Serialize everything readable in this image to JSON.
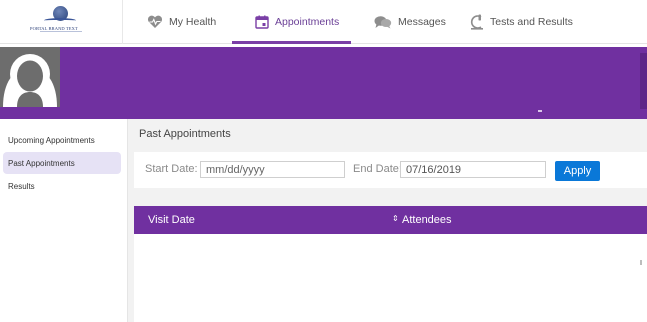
{
  "nav": {
    "logo_text": "PORTAL BRAND TEXT",
    "tabs": [
      {
        "label": "My Health",
        "icon": "heart-pulse-icon"
      },
      {
        "label": "Appointments",
        "icon": "calendar-icon",
        "active": true
      },
      {
        "label": "Messages",
        "icon": "chat-bubbles-icon"
      },
      {
        "label": "Tests and Results",
        "icon": "microscope-icon"
      }
    ]
  },
  "sidebar": {
    "items": [
      {
        "label": "Upcoming Appointments"
      },
      {
        "label": "Past Appointments",
        "active": true
      },
      {
        "label": "Results"
      }
    ]
  },
  "main": {
    "title": "Past Appointments",
    "filters": {
      "start_label": "Start Date:",
      "start_placeholder": "mm/dd/yyyy",
      "end_label": "End Date:",
      "end_value": "07/16/2019",
      "apply_label": "Apply"
    },
    "table": {
      "columns": [
        "Visit Date",
        "Attendees"
      ]
    }
  },
  "colors": {
    "brand_purple": "#7030a0",
    "apply_blue": "#0a78d8"
  }
}
